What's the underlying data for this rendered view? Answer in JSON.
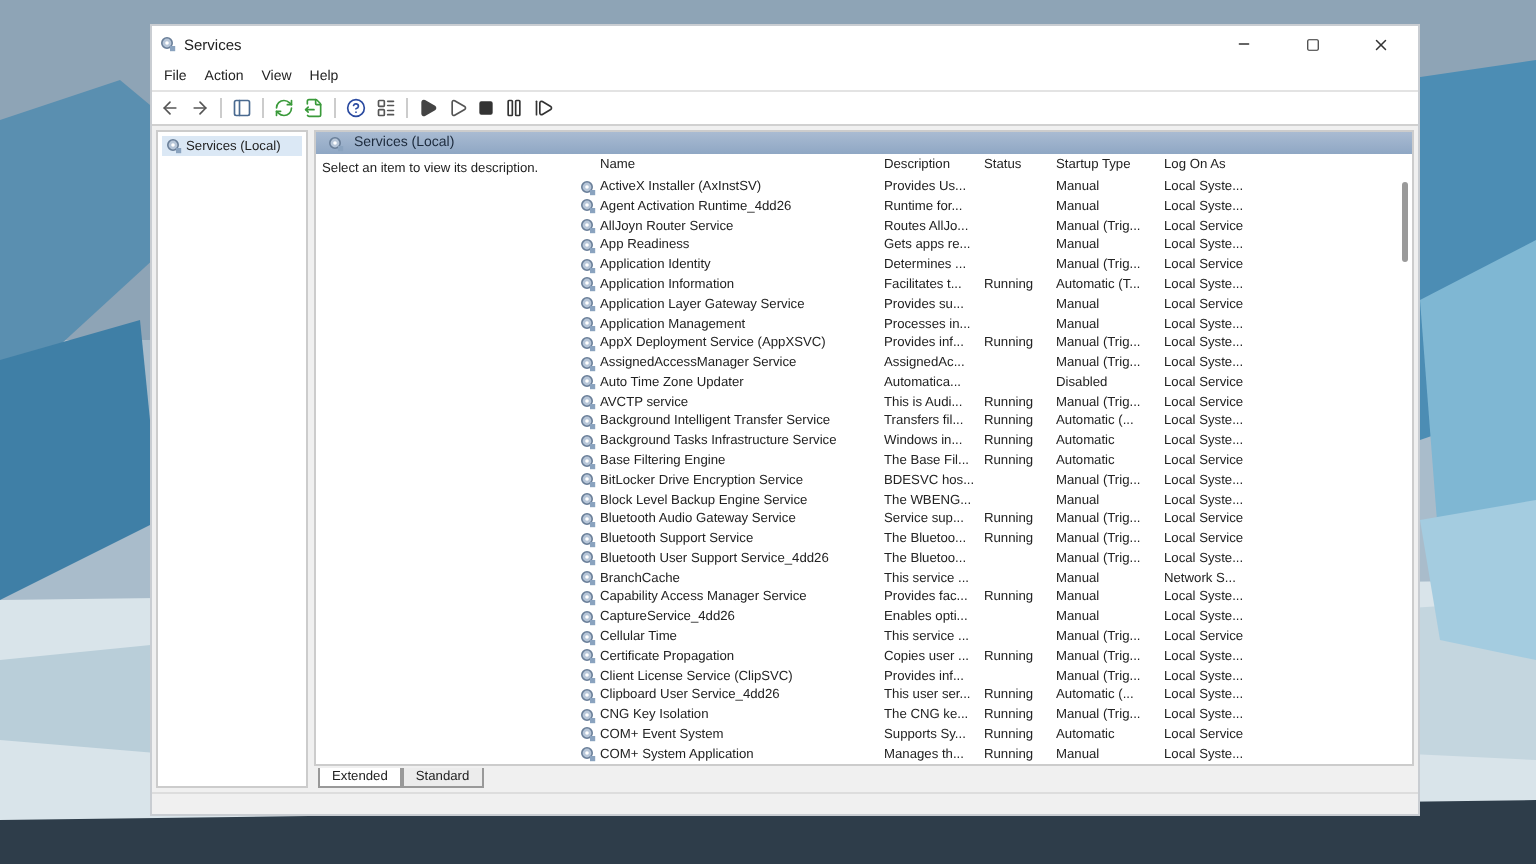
{
  "window": {
    "title": "Services"
  },
  "menu": [
    "File",
    "Action",
    "View",
    "Help"
  ],
  "tree": [
    {
      "label": "Services (Local)",
      "selected": true
    }
  ],
  "panel": {
    "title": "Services (Local)",
    "description": "Select an item to view its description."
  },
  "table": {
    "columns": [
      "Name",
      "Description",
      "Status",
      "Startup Type",
      "Log On As"
    ],
    "rows": [
      [
        "ActiveX Installer (AxInstSV)",
        "Provides Us...",
        "",
        "Manual",
        "Local Syste..."
      ],
      [
        "Agent Activation Runtime_4dd26",
        "Runtime for...",
        "",
        "Manual",
        "Local Syste..."
      ],
      [
        "AllJoyn Router Service",
        "Routes AllJo...",
        "",
        "Manual (Trig...",
        "Local Service"
      ],
      [
        "App Readiness",
        "Gets apps re...",
        "",
        "Manual",
        "Local Syste..."
      ],
      [
        "Application Identity",
        "Determines ...",
        "",
        "Manual (Trig...",
        "Local Service"
      ],
      [
        "Application Information",
        "Facilitates t...",
        "Running",
        "Automatic (T...",
        "Local Syste..."
      ],
      [
        "Application Layer Gateway Service",
        "Provides su...",
        "",
        "Manual",
        "Local Service"
      ],
      [
        "Application Management",
        "Processes in...",
        "",
        "Manual",
        "Local Syste..."
      ],
      [
        "AppX Deployment Service (AppXSVC)",
        "Provides inf...",
        "Running",
        "Manual (Trig...",
        "Local Syste..."
      ],
      [
        "AssignedAccessManager Service",
        "AssignedAc...",
        "",
        "Manual (Trig...",
        "Local Syste..."
      ],
      [
        "Auto Time Zone Updater",
        "Automatica...",
        "",
        "Disabled",
        "Local Service"
      ],
      [
        "AVCTP service",
        "This is Audi...",
        "Running",
        "Manual (Trig...",
        "Local Service"
      ],
      [
        "Background Intelligent Transfer Service",
        "Transfers fil...",
        "Running",
        "Automatic (...",
        "Local Syste..."
      ],
      [
        "Background Tasks Infrastructure Service",
        "Windows in...",
        "Running",
        "Automatic",
        "Local Syste..."
      ],
      [
        "Base Filtering Engine",
        "The Base Fil...",
        "Running",
        "Automatic",
        "Local Service"
      ],
      [
        "BitLocker Drive Encryption Service",
        "BDESVC hos...",
        "",
        "Manual (Trig...",
        "Local Syste..."
      ],
      [
        "Block Level Backup Engine Service",
        "The WBENG...",
        "",
        "Manual",
        "Local Syste..."
      ],
      [
        "Bluetooth Audio Gateway Service",
        "Service sup...",
        "Running",
        "Manual (Trig...",
        "Local Service"
      ],
      [
        "Bluetooth Support Service",
        "The Bluetoo...",
        "Running",
        "Manual (Trig...",
        "Local Service"
      ],
      [
        "Bluetooth User Support Service_4dd26",
        "The Bluetoo...",
        "",
        "Manual (Trig...",
        "Local Syste..."
      ],
      [
        "BranchCache",
        "This service ...",
        "",
        "Manual",
        "Network S..."
      ],
      [
        "Capability Access Manager Service",
        "Provides fac...",
        "Running",
        "Manual",
        "Local Syste..."
      ],
      [
        "CaptureService_4dd26",
        "Enables opti...",
        "",
        "Manual",
        "Local Syste..."
      ],
      [
        "Cellular Time",
        "This service ...",
        "",
        "Manual (Trig...",
        "Local Service"
      ],
      [
        "Certificate Propagation",
        "Copies user ...",
        "Running",
        "Manual (Trig...",
        "Local Syste..."
      ],
      [
        "Client License Service (ClipSVC)",
        "Provides inf...",
        "",
        "Manual (Trig...",
        "Local Syste..."
      ],
      [
        "Clipboard User Service_4dd26",
        "This user ser...",
        "Running",
        "Automatic (...",
        "Local Syste..."
      ],
      [
        "CNG Key Isolation",
        "The CNG ke...",
        "Running",
        "Manual (Trig...",
        "Local Syste..."
      ],
      [
        "COM+ Event System",
        "Supports Sy...",
        "Running",
        "Automatic",
        "Local Service"
      ],
      [
        "COM+ System Application",
        "Manages th...",
        "Running",
        "Manual",
        "Local Syste..."
      ]
    ]
  },
  "tabs": [
    {
      "label": "Extended",
      "selected": true
    },
    {
      "label": "Standard",
      "selected": false
    }
  ]
}
